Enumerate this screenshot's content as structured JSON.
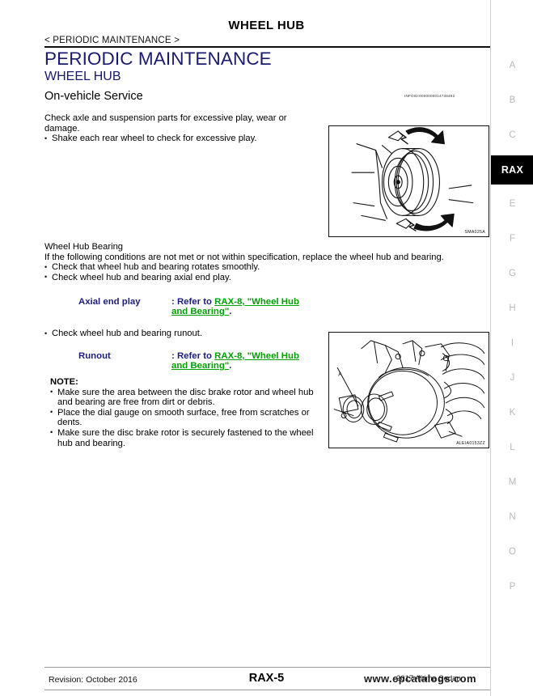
{
  "page": {
    "running_head": "WHEEL HUB",
    "breadcrumb": "< PERIODIC MAINTENANCE >",
    "section_title": "PERIODIC MAINTENANCE",
    "sub_title": "WHEEL HUB",
    "service_title": "On-vehicle Service",
    "infoid": "INFOID:0000000014738492"
  },
  "intro": {
    "lead": "Check axle and suspension parts for excessive play, wear or damage.",
    "bullets": [
      "Shake each rear wheel to check for excessive play."
    ]
  },
  "bearing": {
    "heading": "Wheel Hub Bearing",
    "lead": "If the following conditions are not met or not within specification, replace the wheel hub and bearing.",
    "bullets": [
      "Check that wheel hub and bearing rotates smoothly.",
      "Check wheel hub and bearing axial end play."
    ]
  },
  "spec_axial": {
    "name": "Axial end play",
    "prefix": ": Refer to ",
    "link": "RAX-8, \"Wheel Hub and Bearing\"",
    "suffix": "."
  },
  "runout": {
    "bullets": [
      "Check wheel hub and bearing runout."
    ]
  },
  "spec_runout": {
    "name": "Runout",
    "prefix": ": Refer to ",
    "link": "RAX-8, \"Wheel Hub and Bearing\"",
    "suffix": "."
  },
  "note": {
    "label": "NOTE:",
    "bullets": [
      "Make sure the area between the disc brake rotor and wheel hub and bearing are free from dirt or debris.",
      "Place the dial gauge on smooth surface, free from scratches or dents.",
      "Make sure the disc brake rotor is securely fastened to the wheel hub and bearing."
    ]
  },
  "figures": [
    {
      "name": "rear-wheel-shake-check",
      "code": "SMA025A"
    },
    {
      "name": "wheel-hub-runout-measurement",
      "code": "ALEIA0153ZZ"
    }
  ],
  "tab_rail": {
    "items": [
      {
        "label": "A",
        "active": false
      },
      {
        "label": "B",
        "active": false
      },
      {
        "label": "C",
        "active": false
      },
      {
        "label": "RAX",
        "active": true
      },
      {
        "label": "E",
        "active": false
      },
      {
        "label": "F",
        "active": false
      },
      {
        "label": "G",
        "active": false
      },
      {
        "label": "H",
        "active": false
      },
      {
        "label": "I",
        "active": false
      },
      {
        "label": "J",
        "active": false
      },
      {
        "label": "K",
        "active": false
      },
      {
        "label": "L",
        "active": false
      },
      {
        "label": "M",
        "active": false
      },
      {
        "label": "N",
        "active": false
      },
      {
        "label": "O",
        "active": false
      },
      {
        "label": "P",
        "active": false
      }
    ]
  },
  "footer": {
    "revision": "Revision: October 2016",
    "page_number": "RAX-5",
    "model": "2017 Altima Sedan",
    "watermark": "www.epcatalogs.com"
  },
  "colors": {
    "heading_blue": "#1a1a6e",
    "spec_blue": "#1d1d7a",
    "link_green": "#00a000",
    "tab_active_bg": "#000000",
    "tab_inactive": "#b9b9b9"
  }
}
